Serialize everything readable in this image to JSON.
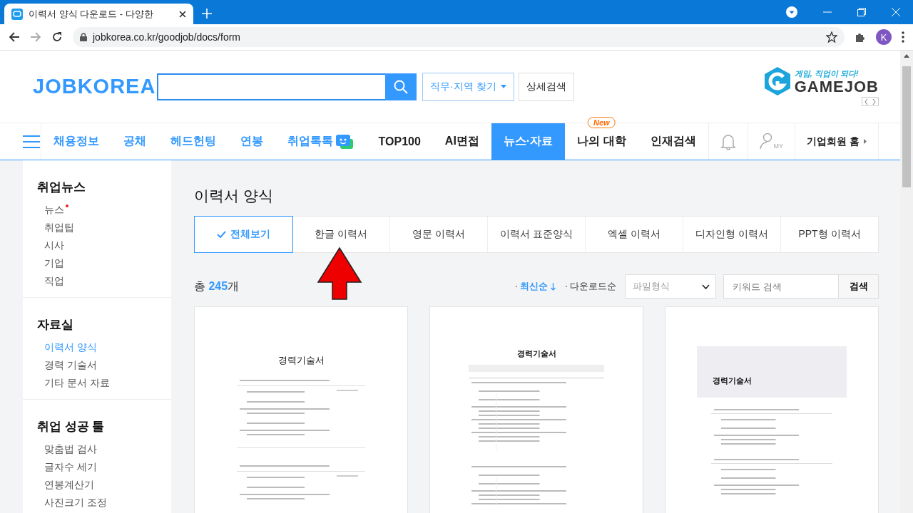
{
  "browser": {
    "tab_title": "이력서 양식 다운로드 - 다양한 ",
    "url": "jobkorea.co.kr/goodjob/docs/form",
    "profile": "K"
  },
  "header": {
    "logo": "JOBKOREA",
    "find_button": "직무·지역 찾기",
    "detail_button": "상세검색",
    "ad_tagline": "게임, 직업이 되다!",
    "ad_brand": "GAMEJOB"
  },
  "nav": {
    "items": [
      {
        "label": "채용정보",
        "selected": false,
        "kind": "blue"
      },
      {
        "label": "공채",
        "selected": false,
        "kind": "blue"
      },
      {
        "label": "헤드헌팅",
        "selected": false,
        "kind": "blue"
      },
      {
        "label": "연봉",
        "selected": false,
        "kind": "blue"
      },
      {
        "label": "취업톡톡",
        "selected": false,
        "kind": "chat"
      },
      {
        "label": "TOP100",
        "selected": false,
        "kind": "plain"
      },
      {
        "label": "AI면접",
        "selected": false,
        "kind": "plain"
      },
      {
        "label": "뉴스·자료",
        "selected": true,
        "kind": "plain"
      },
      {
        "label": "나의 대학",
        "selected": false,
        "kind": "plain",
        "badge": "New"
      },
      {
        "label": "인재검색",
        "selected": false,
        "kind": "plain"
      }
    ],
    "my_label": "MY",
    "corporate_link": "기업회원 홈"
  },
  "sidebar": [
    {
      "title": "취업뉴스",
      "items": [
        {
          "label": "뉴스",
          "selected": false,
          "dot": true
        },
        {
          "label": "취업팁",
          "selected": false,
          "dot": false
        },
        {
          "label": "시사",
          "selected": false,
          "dot": false
        },
        {
          "label": "기업",
          "selected": false,
          "dot": false
        },
        {
          "label": "직업",
          "selected": false,
          "dot": false
        }
      ]
    },
    {
      "title": "자료실",
      "items": [
        {
          "label": "이력서 양식",
          "selected": true,
          "dot": false
        },
        {
          "label": "경력 기술서",
          "selected": false,
          "dot": false
        },
        {
          "label": "기타 문서 자료",
          "selected": false,
          "dot": false
        }
      ]
    },
    {
      "title": "취업 성공 툴",
      "items": [
        {
          "label": "맞춤법 검사",
          "selected": false,
          "dot": false
        },
        {
          "label": "글자수 세기",
          "selected": false,
          "dot": false
        },
        {
          "label": "연봉계산기",
          "selected": false,
          "dot": false
        },
        {
          "label": "사진크기 조정",
          "selected": false,
          "dot": false
        }
      ]
    }
  ],
  "main": {
    "title": "이력서 양식",
    "tabs": [
      {
        "label": "전체보기",
        "selected": true
      },
      {
        "label": "한글 이력서",
        "selected": false
      },
      {
        "label": "영문 이력서",
        "selected": false
      },
      {
        "label": "이력서 표준양식",
        "selected": false
      },
      {
        "label": "엑셀 이력서",
        "selected": false
      },
      {
        "label": "디자인형 이력서",
        "selected": false
      },
      {
        "label": "PPT형 이력서",
        "selected": false
      }
    ],
    "total_prefix": "총",
    "total_count": "245",
    "total_suffix": "개",
    "sort_options": [
      {
        "label": "최신순",
        "selected": true
      },
      {
        "label": "다운로드순",
        "selected": false
      }
    ],
    "file_type": {
      "placeholder": "파일형식"
    },
    "keyword": {
      "placeholder": "키워드 검색"
    },
    "search_button": "검색",
    "cards": [
      {
        "title": "경력기술서",
        "kind": "centered"
      },
      {
        "title": "경력기술서",
        "kind": "table"
      },
      {
        "title": "경력기술서",
        "kind": "banner"
      }
    ]
  }
}
